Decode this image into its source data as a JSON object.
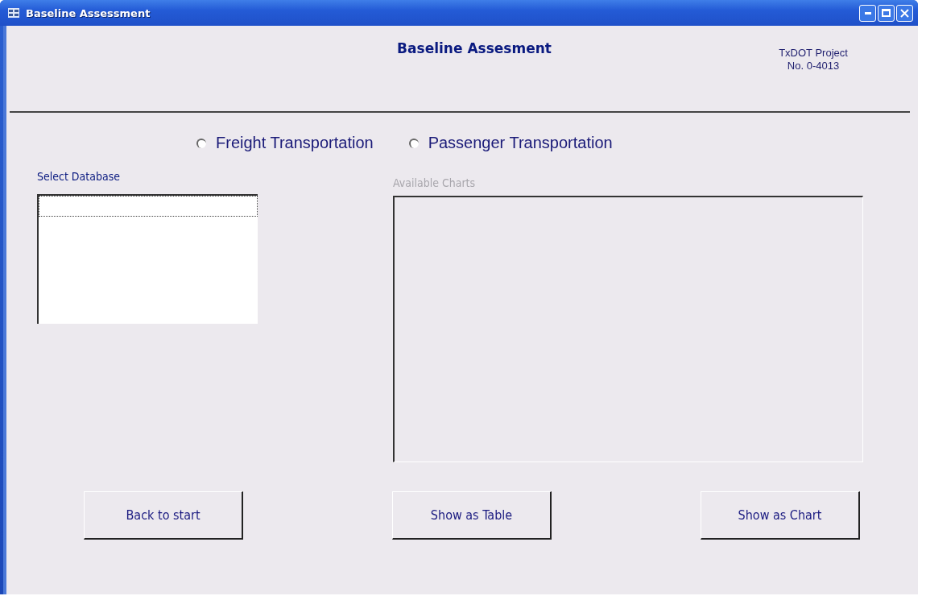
{
  "window": {
    "title": "Baseline Assessment"
  },
  "header": {
    "title": "Baseline Assesment",
    "project_line_1": "TxDOT Project",
    "project_line_2": "No. 0-4013"
  },
  "transport_options": [
    {
      "label": "Freight Transportation",
      "selected": false
    },
    {
      "label": "Passenger Transportation",
      "selected": false
    }
  ],
  "select_database": {
    "label": "Select Database"
  },
  "available_charts": {
    "label": "Available Charts",
    "disabled": true
  },
  "buttons": [
    {
      "label": "Back to start"
    },
    {
      "label": "Show as Table"
    },
    {
      "label": "Show as Chart"
    }
  ]
}
